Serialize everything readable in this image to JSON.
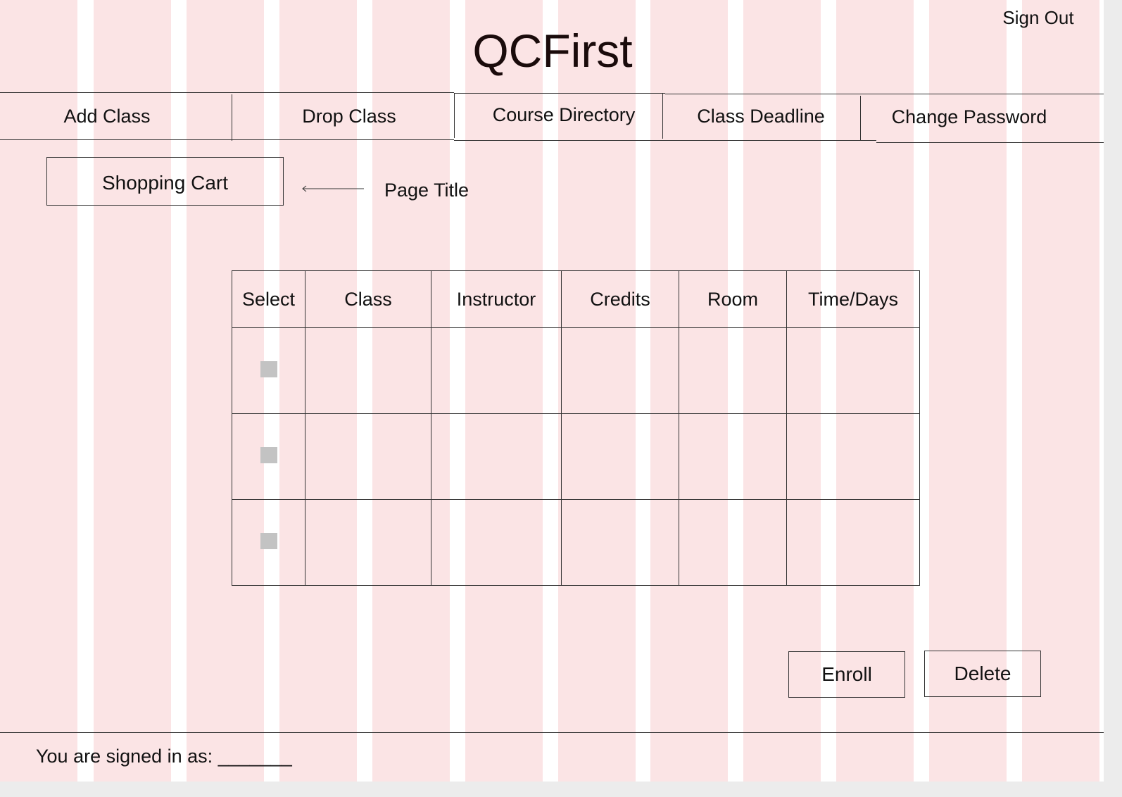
{
  "header": {
    "app_title": "QCFirst",
    "sign_out_label": "Sign Out"
  },
  "nav": {
    "items": [
      {
        "label": "Add Class"
      },
      {
        "label": "Drop Class"
      },
      {
        "label": "Course Directory"
      },
      {
        "label": "Class Deadline"
      },
      {
        "label": "Change Password"
      }
    ]
  },
  "page": {
    "title": "Shopping Cart",
    "annotation_label": "Page Title"
  },
  "cart_table": {
    "columns": [
      "Select",
      "Class",
      "Instructor",
      "Credits",
      "Room",
      "Time/Days"
    ],
    "rows": [
      {
        "selected": false,
        "class": "",
        "instructor": "",
        "credits": "",
        "room": "",
        "time_days": ""
      },
      {
        "selected": false,
        "class": "",
        "instructor": "",
        "credits": "",
        "room": "",
        "time_days": ""
      },
      {
        "selected": false,
        "class": "",
        "instructor": "",
        "credits": "",
        "room": "",
        "time_days": ""
      }
    ]
  },
  "actions": {
    "enroll_label": "Enroll",
    "delete_label": "Delete"
  },
  "footer": {
    "signed_in_text": "You are signed in as: _______"
  },
  "colors": {
    "grid_column": "#fbe4e5",
    "checkbox": "#c3c3c3",
    "line": "#333333",
    "title_text": "#1a0b0b"
  }
}
